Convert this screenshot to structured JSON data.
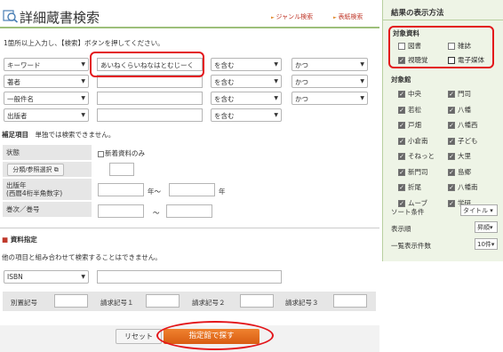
{
  "header": {
    "title": "詳細蔵書検索",
    "links": [
      "ジャンル検索",
      "表紙検索"
    ]
  },
  "instruction": "1箇所以上入力し、【検索】ボタンを押してください。",
  "search_rows": [
    {
      "field": "キーワード",
      "value": "あいねくらいねなはとむじーく",
      "match": "を含む",
      "op": "かつ"
    },
    {
      "field": "著者",
      "value": "",
      "match": "を含む",
      "op": "かつ"
    },
    {
      "field": "一般件名",
      "value": "",
      "match": "を含む",
      "op": "かつ"
    },
    {
      "field": "出版者",
      "value": "",
      "match": "を含む",
      "op": ""
    }
  ],
  "supplement": {
    "heading": "補足項目",
    "note": "単独では検索できません。",
    "state_label": "状態",
    "new_only": "新着資料のみ",
    "class_button": "分類/参照選択",
    "year_label": "出版年\n(西暦4桁半角数字)",
    "year_from_suffix": "年～",
    "year_to_suffix": "年",
    "volume_label": "巻次／巻号",
    "volume_sep": "～"
  },
  "material": {
    "heading": "資料指定",
    "note": "他の項目と組み合わせて検索することはできません。",
    "type": "ISBN",
    "call_labels": [
      "別置記号",
      "請求記号１",
      "請求記号２",
      "請求記号３"
    ]
  },
  "buttons": {
    "reset": "リセット",
    "search": "指定館で探す"
  },
  "sidebar": {
    "title": "結果の表示方法",
    "material_heading": "対象資料",
    "materials": [
      {
        "label": "図書",
        "checked": false
      },
      {
        "label": "雑誌",
        "checked": false
      },
      {
        "label": "視聴覚",
        "checked": true
      },
      {
        "label": "電子媒体",
        "checked": false
      }
    ],
    "library_heading": "対象館",
    "libraries": [
      {
        "label": "中央",
        "checked": true
      },
      {
        "label": "門司",
        "checked": true
      },
      {
        "label": "若松",
        "checked": true
      },
      {
        "label": "八幡",
        "checked": true
      },
      {
        "label": "戸畑",
        "checked": true
      },
      {
        "label": "八幡西",
        "checked": true
      },
      {
        "label": "小倉南",
        "checked": true
      },
      {
        "label": "子ども",
        "checked": true
      },
      {
        "label": "そねっと",
        "checked": true
      },
      {
        "label": "大里",
        "checked": true
      },
      {
        "label": "新門司",
        "checked": true
      },
      {
        "label": "島郷",
        "checked": true
      },
      {
        "label": "折尾",
        "checked": true
      },
      {
        "label": "八幡南",
        "checked": true
      },
      {
        "label": "ムーブ",
        "checked": true
      },
      {
        "label": "学研",
        "checked": true
      }
    ],
    "sort_label": "ソート条件",
    "sort_value": "タイトル",
    "order_label": "表示順",
    "order_value": "昇順",
    "count_label": "一覧表示件数",
    "count_value": "10件"
  }
}
